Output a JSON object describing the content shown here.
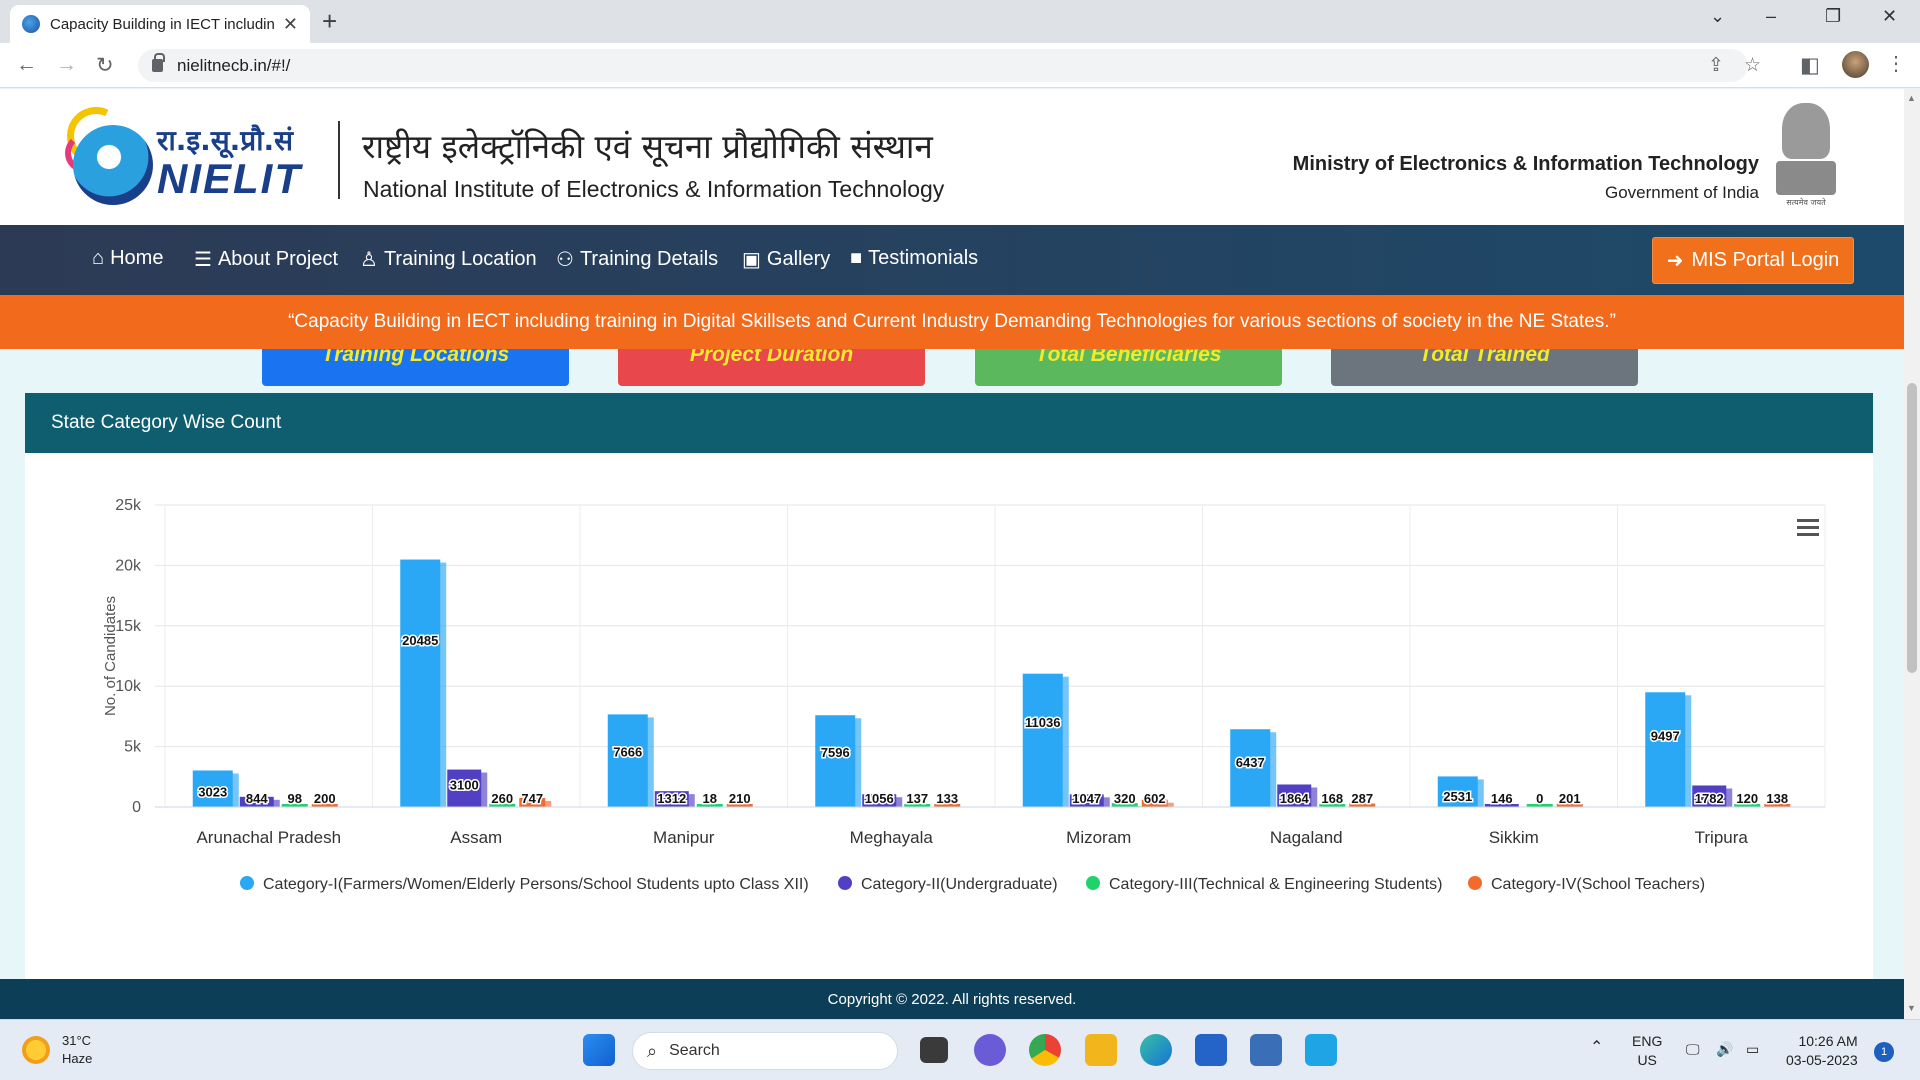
{
  "browser": {
    "tab_title": "Capacity Building in IECT includin",
    "url": "nielitnecb.in/#!/"
  },
  "header": {
    "logo_hindi": "रा.इ.सू.प्रौ.सं",
    "logo_text": "NIELIT",
    "institute_hindi": "राष्ट्रीय इलेक्ट्रॉनिकी एवं सूचना प्रौद्योगिकी संस्थान",
    "institute_english": "National Institute of Electronics & Information Technology",
    "ministry": "Ministry of Electronics & Information Technology",
    "government": "Government of India",
    "emblem_caption": "सत्यमेव जयते"
  },
  "nav": {
    "items": [
      {
        "label": "Home",
        "icon": "home-icon",
        "glyph": "⌂"
      },
      {
        "label": "About Project",
        "icon": "list-icon",
        "glyph": "☰"
      },
      {
        "label": "Training Location",
        "icon": "person-icon",
        "glyph": "♙"
      },
      {
        "label": "Training Details",
        "icon": "users-icon",
        "glyph": "⚇"
      },
      {
        "label": "Gallery",
        "icon": "image-icon",
        "glyph": "▣"
      },
      {
        "label": "Testimonials",
        "icon": "video-icon",
        "glyph": "■"
      }
    ],
    "login_button": "MIS Portal Login"
  },
  "tagline": "“Capacity Building in IECT including training in Digital Skillsets and Current Industry Demanding Technologies for various sections of society in the NE States.”",
  "stat_cards": [
    {
      "label": "Training Locations",
      "color": "#1a73f0"
    },
    {
      "label": "Project Duration",
      "color": "#e8474b"
    },
    {
      "label": "Total Beneficiaries",
      "color": "#5cb85c"
    },
    {
      "label": "Total Trained",
      "color": "#6c757d"
    }
  ],
  "chart_card": {
    "title": "State Category Wise Count"
  },
  "chart_data": {
    "type": "bar",
    "title": "",
    "xlabel": "",
    "ylabel": "No. of Candidates",
    "ylim": [
      0,
      25000
    ],
    "yticks": [
      "0",
      "5k",
      "10k",
      "15k",
      "20k",
      "25k"
    ],
    "legend_position": "bottom",
    "grid": true,
    "categories": [
      "Arunachal Pradesh",
      "Assam",
      "Manipur",
      "Meghayala",
      "Mizoram",
      "Nagaland",
      "Sikkim",
      "Tripura"
    ],
    "series": [
      {
        "name": "Category-I(Farmers/Women/Elderly Persons/School Students upto Class XII)",
        "color": "#2aa8f5",
        "values": [
          3023,
          20485,
          7666,
          7596,
          11036,
          6437,
          2531,
          9497
        ]
      },
      {
        "name": "Category-II(Undergraduate)",
        "color": "#5140c4",
        "values": [
          844,
          3100,
          1312,
          1056,
          1047,
          1864,
          146,
          1782
        ]
      },
      {
        "name": "Category-III(Technical & Engineering Students)",
        "color": "#1ed46a",
        "values": [
          98,
          260,
          18,
          137,
          320,
          168,
          0,
          120
        ]
      },
      {
        "name": "Category-IV(School Teachers)",
        "color": "#f26a2c",
        "values": [
          200,
          747,
          210,
          133,
          602,
          287,
          201,
          138
        ]
      }
    ]
  },
  "footer": "Copyright © 2022. All rights reserved.",
  "taskbar": {
    "temperature": "31°C",
    "weather": "Haze",
    "search_placeholder": "Search",
    "lang1": "ENG",
    "lang2": "US",
    "time": "10:26 AM",
    "date": "03-05-2023",
    "notifications": "1"
  }
}
